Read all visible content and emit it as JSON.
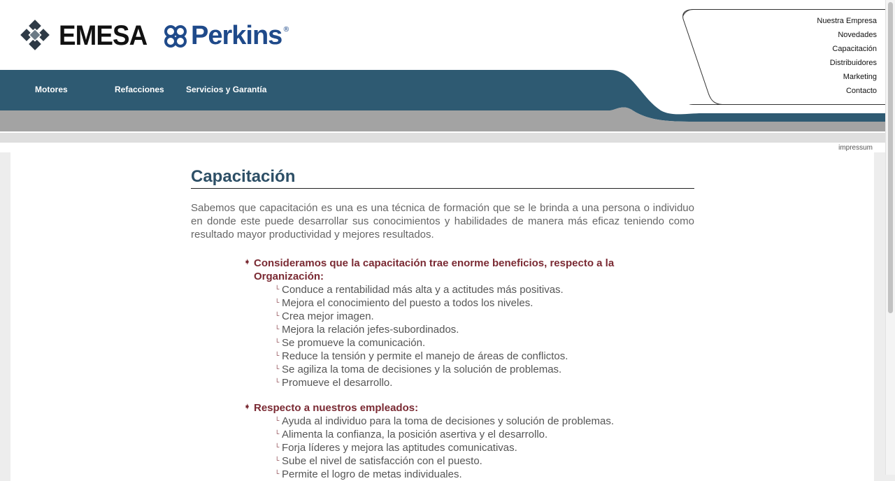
{
  "brand": {
    "emesa": "EMESA",
    "perkins": "Perkins",
    "perkins_reg": "®"
  },
  "colors": {
    "band": "#2e5a72",
    "gray_band": "#a3a3a3",
    "title": "#2d4f66",
    "accent": "#7a2a33"
  },
  "nav": {
    "motores": "Motores",
    "refacciones": "Refacciones",
    "servicios": "Servicios y Garantía"
  },
  "quicknav": [
    "Nuestra Empresa",
    "Novedades",
    "Capacitación",
    "Distribuidores",
    "Marketing",
    "Contacto"
  ],
  "impressum": "impressum",
  "page": {
    "title": "Capacitación",
    "intro": "Sabemos que capacitación es una es una técnica de formación que se le brinda a una persona o individuo en donde este puede desarrollar sus conocimientos y habilidades de manera más eficaz teniendo como resultado mayor productividad y mejores resultados."
  },
  "sections": [
    {
      "heading": "Consideramos que la capacitación trae enorme beneficios, respecto a la Organización:",
      "items": [
        "Conduce a rentabilidad más alta y a actitudes más positivas.",
        "Mejora el conocimiento del puesto a todos los niveles.",
        "Crea mejor imagen.",
        "Mejora la relación jefes-subordinados.",
        "Se promueve la comunicación.",
        "Reduce la tensión y permite el manejo de áreas de conflictos.",
        "Se agiliza la toma de decisiones y la solución de problemas.",
        "Promueve el desarrollo."
      ]
    },
    {
      "heading": "Respecto a nuestros empleados:",
      "items": [
        "Ayuda al individuo para la toma de decisiones y solución de problemas.",
        "Alimenta la confianza, la posición asertiva y el desarrollo.",
        "Forja líderes y mejora las aptitudes comunicativas.",
        "Sube el nivel de satisfacción con el puesto.",
        "Permite el logro de metas individuales."
      ]
    }
  ],
  "icons": {
    "section_marker": "diamond-arrow-icon",
    "item_bullet": "corner-bullet-icon"
  }
}
